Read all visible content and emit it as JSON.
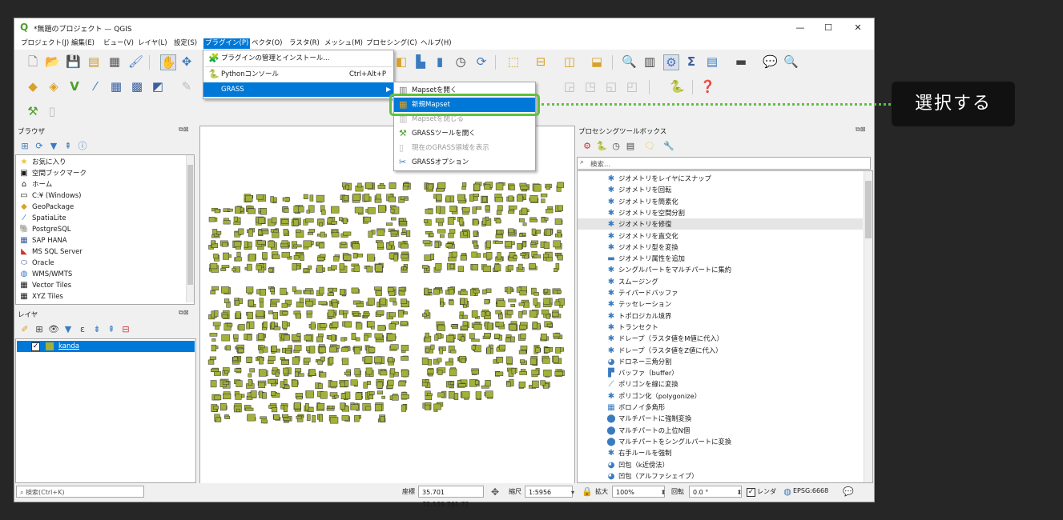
{
  "window": {
    "title": "*無題のプロジェクト — QGIS",
    "minimize": "—",
    "maximize": "☐",
    "close": "✕"
  },
  "menubar": [
    {
      "label": "プロジェクト(J)"
    },
    {
      "label": "編集(E)"
    },
    {
      "label": "ビュー(V)"
    },
    {
      "label": "レイヤ(L)"
    },
    {
      "label": "設定(S)"
    },
    {
      "label": "プラグイン(P)",
      "active": true
    },
    {
      "label": "ベクタ(O)"
    },
    {
      "label": "ラスタ(R)"
    },
    {
      "label": "メッシュ(M)"
    },
    {
      "label": "プロセシング(C)"
    },
    {
      "label": "ヘルプ(H)"
    }
  ],
  "plugin_menu": [
    {
      "label": "プラグインの管理とインストール...",
      "shortcut": ""
    },
    {
      "label": "Pythonコンソール",
      "shortcut": "Ctrl+Alt+P"
    },
    {
      "label": "GRASS",
      "shortcut": "",
      "submenu": true
    }
  ],
  "grass_submenu": [
    {
      "label": "Mapsetを開く",
      "state": "normal"
    },
    {
      "label": "新規Mapset",
      "state": "selected"
    },
    {
      "label": "Mapsetを閉じる",
      "state": "disabled"
    },
    {
      "label": "GRASSツールを開く",
      "state": "normal"
    },
    {
      "label": "現在のGRASS領域を表示",
      "state": "disabled"
    },
    {
      "label": "GRASSオプション",
      "state": "normal"
    }
  ],
  "browser_panel": {
    "title": "ブラウザ",
    "items": [
      "お気に入り",
      "空間ブックマーク",
      "ホーム",
      "C:¥ (Windows)",
      "GeoPackage",
      "SpatiaLite",
      "PostgreSQL",
      "SAP HANA",
      "MS SQL Server",
      "Oracle",
      "WMS/WMTS",
      "Vector Tiles",
      "XYZ Tiles"
    ]
  },
  "layers_panel": {
    "title": "レイヤ",
    "layer_name": "kanda"
  },
  "processing_panel": {
    "title": "プロセシングツールボックス",
    "search_placeholder": "検索...",
    "tools": [
      "ジオメトリをレイヤにスナップ",
      "ジオメトリを回転",
      "ジオメトリを簡素化",
      "ジオメトリを空間分割",
      "ジオメトリを修復",
      "ジオメトリを直交化",
      "ジオメトリ型を変換",
      "ジオメトリ属性を追加",
      "シングルパートをマルチパートに集約",
      "スムージング",
      "テイパードバッファ",
      "テッセレーション",
      "トポロジカル境界",
      "トランセクト",
      "ドレープ（ラスタ値をM値に代入）",
      "ドレープ（ラスタ値をZ値に代入）",
      "ドロネー三角分割",
      "バッファ（buffer）",
      "ポリゴンを線に変換",
      "ポリゴン化（polygonize）",
      "ボロノイ多角形",
      "マルチパートに強制変換",
      "マルチパートの上位N個",
      "マルチパートをシングルパートに変換",
      "右手ルールを強制",
      "凹包（k近傍法）",
      "凹包（アルファシェイプ）"
    ]
  },
  "statusbar": {
    "search_placeholder": "検索(Ctrl+K)",
    "coord_label": "座標",
    "coord_value": "35.701 72,139.761 72",
    "scale_label": "縮尺",
    "scale_value": "1:5956",
    "magnifier_label": "拡大",
    "magnifier_value": "100%",
    "rotation_label": "回転",
    "rotation_value": "0.0 °",
    "render_label": "レンダ",
    "crs": "EPSG:6668"
  },
  "callout": {
    "text": "選択する"
  },
  "colors": {
    "accent": "#0078d7",
    "highlight": "#5fc13c",
    "building_fill": "#a3b13a"
  }
}
